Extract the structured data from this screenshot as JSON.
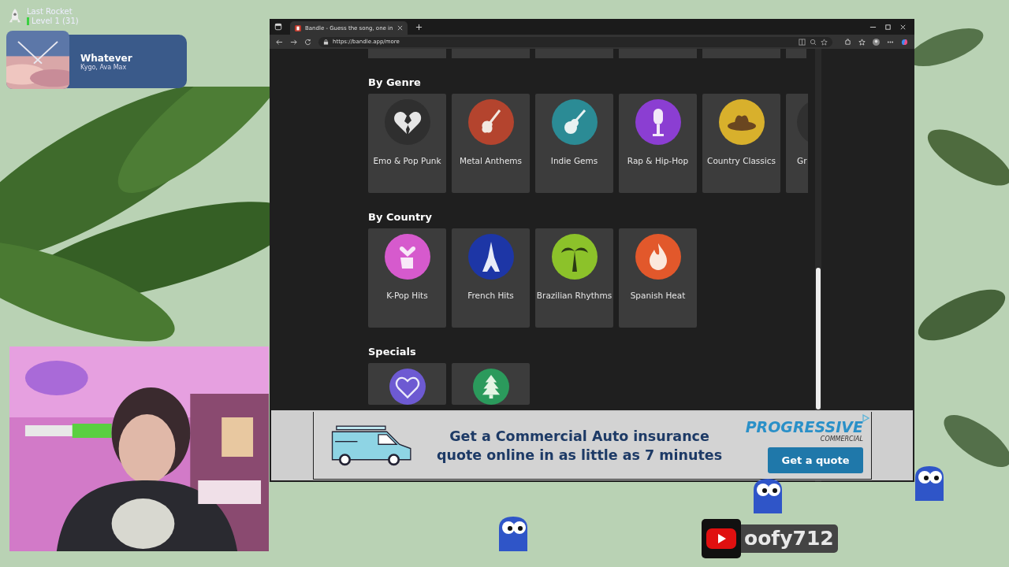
{
  "stream_overlay": {
    "achievement": {
      "title": "Last Rocket",
      "level": "Level 1  (31)"
    },
    "now_playing": {
      "kind": "picture",
      "title": "Whatever",
      "artist": "Kygo, Ava Max"
    },
    "channel": {
      "name": "oofy712"
    }
  },
  "browser": {
    "tab": {
      "title": "Bandle - Guess the song, one in",
      "selected": true
    },
    "url": "https://bandle.app/more"
  },
  "sections": [
    {
      "heading": "By Genre",
      "tiles": [
        {
          "label": "Emo & Pop Punk",
          "color": "#2f2f2f"
        },
        {
          "label": "Metal Anthems",
          "color": "#b4442e"
        },
        {
          "label": "Indie Gems",
          "color": "#2b8b95"
        },
        {
          "label": "Rap & Hip-Hop",
          "color": "#8b3ed2"
        },
        {
          "label": "Country Classics",
          "color": "#d8b02c"
        },
        {
          "label": "Gr",
          "color": "#303030"
        }
      ]
    },
    {
      "heading": "By Country",
      "tiles": [
        {
          "label": "K-Pop Hits",
          "color": "#d65acd"
        },
        {
          "label": "French Hits",
          "color": "#1d36a6"
        },
        {
          "label": "Brazilian Rhythms",
          "color": "#8cc22a"
        },
        {
          "label": "Spanish Heat",
          "color": "#e2582b"
        }
      ]
    },
    {
      "heading": "Specials",
      "tiles": [
        {
          "color": "#6d5ad2"
        },
        {
          "color": "#2b9a5c"
        }
      ]
    }
  ],
  "ad": {
    "headline": "Get a Commercial Auto insurance quote online in as little as 7 minutes",
    "brand": "PROGRESSIVE",
    "brand_sub": "COMMERCIAL",
    "button": "Get a quote"
  }
}
